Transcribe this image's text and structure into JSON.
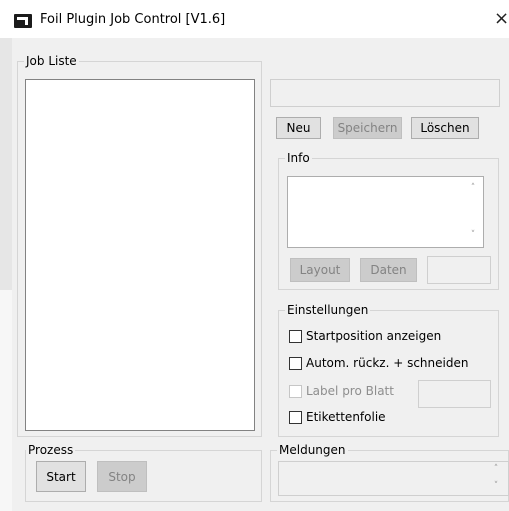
{
  "window": {
    "title": "Foil Plugin Job Control [V1.6]",
    "close_glyph": "×",
    "app_icon": "app-logo-icon"
  },
  "job_list": {
    "legend": "Job Liste",
    "items": []
  },
  "job_name_field": {
    "value": ""
  },
  "job_buttons": {
    "new_label": "Neu",
    "save_label": "Speichern",
    "delete_label": "Löschen"
  },
  "info": {
    "legend": "Info",
    "text": "",
    "layout_label": "Layout",
    "data_label": "Daten",
    "side_field_value": ""
  },
  "settings": {
    "legend": "Einstellungen",
    "show_start_position": {
      "label": "Startposition anzeigen",
      "checked": false
    },
    "auto_return_cut": {
      "label": "Autom. rückz. + schneiden",
      "checked": false
    },
    "label_per_sheet": {
      "label": "Label pro Blatt",
      "checked": false,
      "value": ""
    },
    "label_foil": {
      "label": "Etikettenfolie",
      "checked": false
    }
  },
  "process": {
    "legend": "Prozess",
    "start_label": "Start",
    "stop_label": "Stop"
  },
  "messages": {
    "legend": "Meldungen",
    "text": ""
  }
}
